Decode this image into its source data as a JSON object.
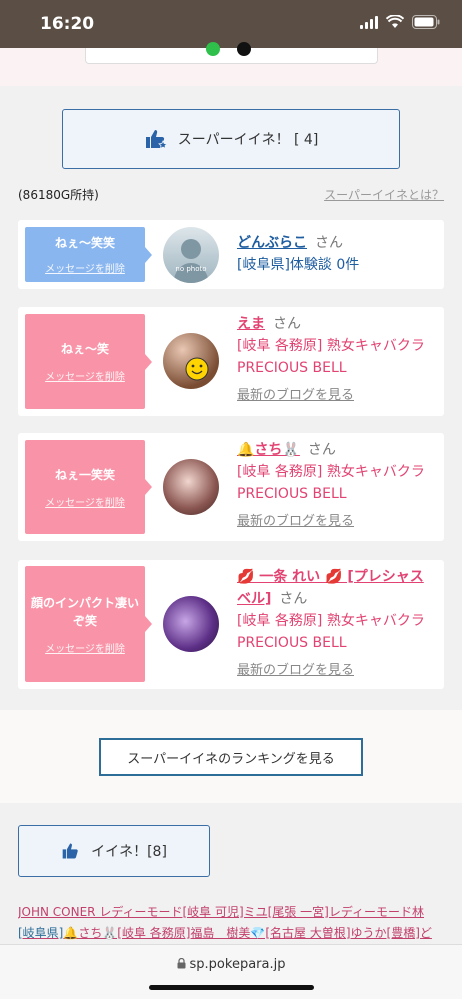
{
  "status_bar": {
    "time": "16:20"
  },
  "super_like": {
    "label": "スーパーイイネ！ [ 4]",
    "owned": "(86180G所持)",
    "what_is": "スーパーイイネとは？"
  },
  "messages": [
    {
      "message": "ねぇ〜笑笑",
      "delete": "メッセージを削除",
      "name": "どんぶらこ",
      "san": "さん",
      "area": "[岐阜県]体験談 0件",
      "shop": "",
      "blog": "",
      "avatar_label": "no photo"
    },
    {
      "message": "ねぇ〜笑",
      "delete": "メッセージを削除",
      "name": "えま",
      "san": "さん",
      "area": "[岐阜 各務原]  熟女キャバクラ",
      "shop": "PRECIOUS BELL",
      "blog": "最新のブログを見る"
    },
    {
      "message": "ねぇ一笑笑",
      "delete": "メッセージを削除",
      "name": "🔔さち🐰",
      "san": "さん",
      "area": "[岐阜 各務原]  熟女キャバクラ",
      "shop": "PRECIOUS BELL",
      "blog": "最新のブログを見る"
    },
    {
      "message": "顔のインパクト凄いぞ笑",
      "delete": "メッセージを削除",
      "name": "💋 一条 れい 💋 [プレシャスベル]",
      "san": "さん",
      "area": "[岐阜 各務原]  熟女キャバクラ",
      "shop": "PRECIOUS BELL",
      "blog": "最新のブログを見る"
    }
  ],
  "ranking_button": "スーパーイイネのランキングを見る",
  "like_button": "イイネ！[8]",
  "links": {
    "line1": "JOHN CONER レディーモード[岐阜 可児]ミユ[尾張 一宮]レディーモード林",
    "line2a": "[岐阜県]",
    "line2b": "🔔さち🐰[岐阜 各務原]福島　樹美💎[名古屋 大曽根]ゆうか[豊橋]ど"
  },
  "browser": {
    "url": "sp.pokepara.jp"
  },
  "colors": {
    "pink": "#f994a8",
    "blue": "#8ab6f0",
    "accent": "#2d6e99"
  }
}
